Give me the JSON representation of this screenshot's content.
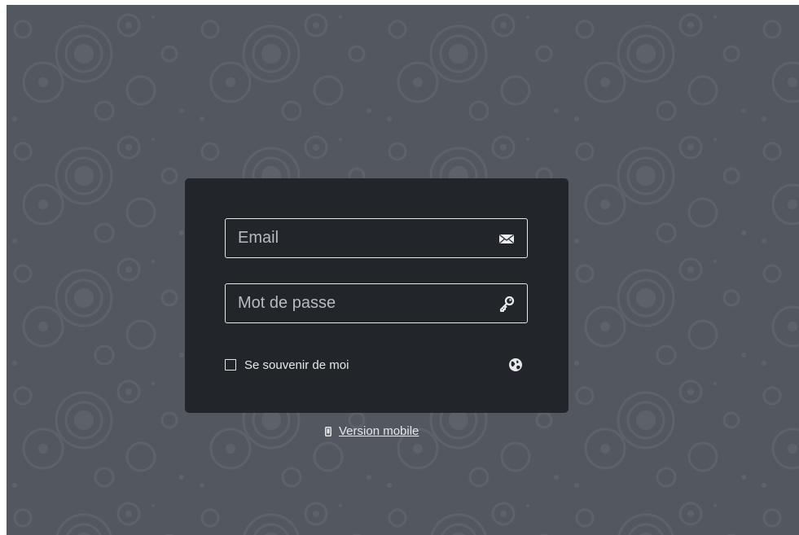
{
  "login_form": {
    "email": {
      "placeholder": "Email",
      "value": "",
      "icon": "envelope-icon"
    },
    "password": {
      "placeholder": "Mot de passe",
      "value": "",
      "icon": "key-icon"
    },
    "remember_me": {
      "label": "Se souvenir de moi",
      "checked": false
    },
    "language_icon": "globe-icon"
  },
  "footer": {
    "mobile_link_label": "Version mobile",
    "mobile_icon": "mobile-phone-icon"
  },
  "colors": {
    "background": "#535860",
    "panel": "#1e2126",
    "text": "#e6e7e9",
    "placeholder": "#b7bcc2"
  }
}
